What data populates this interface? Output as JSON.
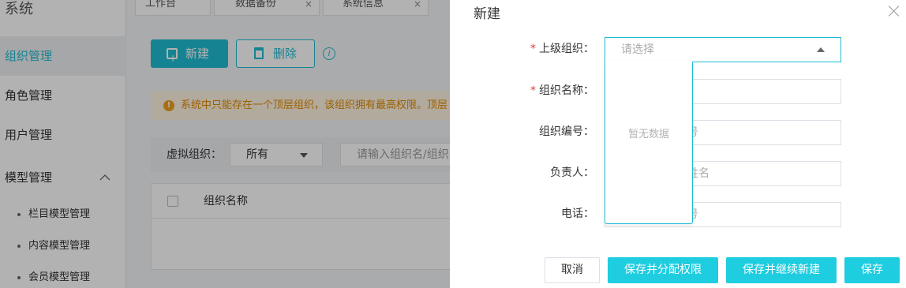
{
  "sidebar": {
    "title": "系统",
    "items": [
      {
        "label": "组织管理"
      },
      {
        "label": "角色管理"
      },
      {
        "label": "用户管理"
      },
      {
        "label": "模型管理"
      }
    ],
    "sub_items": [
      {
        "label": "栏目模型管理"
      },
      {
        "label": "内容模型管理"
      },
      {
        "label": "会员模型管理"
      }
    ],
    "active_color": "#1fbcd2"
  },
  "tabs": [
    {
      "label": "工作台"
    },
    {
      "label": "数据备份",
      "close": "×"
    },
    {
      "label": "系统信息",
      "close": "×"
    }
  ],
  "toolbar": {
    "new_label": "新建",
    "delete_label": "删除",
    "info_glyph": "i"
  },
  "warning": {
    "icon_glyph": "!",
    "text": "系统中只能存在一个顶层组织，该组织拥有最高权限。顶层"
  },
  "filter": {
    "label": "虚拟组织：",
    "select_value": "所有",
    "search_placeholder": "请输入组织名/组织"
  },
  "table": {
    "columns": [
      "组织名称"
    ]
  },
  "drawer": {
    "title": "新建",
    "fields": [
      {
        "label": "上级组织：",
        "required": true,
        "placeholder": "请选择"
      },
      {
        "label": "组织名称：",
        "required": true,
        "placeholder": ""
      },
      {
        "label": "组织编号：",
        "required": false,
        "placeholder": "号"
      },
      {
        "label": "负责人：",
        "required": false,
        "placeholder": "姓名"
      },
      {
        "label": "电话：",
        "required": false,
        "placeholder": "号"
      }
    ],
    "required_mark": "*",
    "dropdown_empty": "暂无数据",
    "buttons": {
      "cancel": "取消",
      "save_assign": "保存并分配权限",
      "save_continue": "保存并继续新建",
      "save": "保存"
    },
    "accent_color": "#1fcde0"
  }
}
